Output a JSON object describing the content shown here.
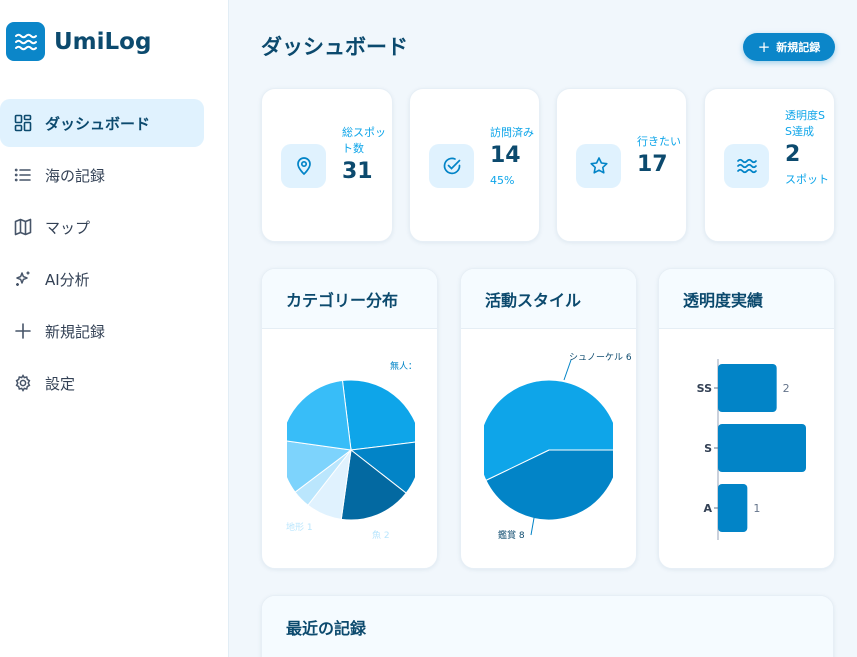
{
  "app": {
    "name": "UmiLog"
  },
  "sidebar": {
    "items": [
      {
        "label": "ダッシュボード",
        "icon": "grid-icon",
        "active": true
      },
      {
        "label": "海の記録",
        "icon": "list-icon",
        "active": false
      },
      {
        "label": "マップ",
        "icon": "map-icon",
        "active": false
      },
      {
        "label": "AI分析",
        "icon": "sparkles-icon",
        "active": false
      },
      {
        "label": "新規記録",
        "icon": "plus-icon",
        "active": false
      },
      {
        "label": "設定",
        "icon": "gear-icon",
        "active": false
      }
    ]
  },
  "header": {
    "title": "ダッシュボード",
    "new_button": "新規記録"
  },
  "stats": [
    {
      "label": "総スポット数",
      "value": "31",
      "sub": "",
      "icon": "pin-icon"
    },
    {
      "label": "訪問済み",
      "value": "14",
      "sub": "45%",
      "icon": "check-circle-icon"
    },
    {
      "label": "行きたい",
      "value": "17",
      "sub": "",
      "icon": "star-icon"
    },
    {
      "label": "透明度SS達成",
      "value": "2",
      "sub": "スポット",
      "icon": "waves-icon"
    }
  ],
  "cards": {
    "category": {
      "title": "カテゴリー分布"
    },
    "style": {
      "title": "活動スタイル"
    },
    "clarity": {
      "title": "透明度実績"
    },
    "recent": {
      "title": "最近の記録"
    }
  },
  "chart_data": [
    {
      "type": "pie",
      "title": "カテゴリー分布",
      "visible_labels": [
        "無人：",
        "地形 1",
        "魚 2"
      ],
      "slices": [
        {
          "label": "無人",
          "value": 6,
          "color": "#0ea5e9"
        },
        {
          "label": "",
          "value": 3,
          "color": "#0284c7"
        },
        {
          "label": "",
          "value": 4,
          "color": "#0369a1"
        },
        {
          "label": "魚",
          "value": 2,
          "color": "#e0f2fe"
        },
        {
          "label": "地形",
          "value": 1,
          "color": "#bae6fd"
        },
        {
          "label": "",
          "value": 3,
          "color": "#7dd3fc"
        },
        {
          "label": "",
          "value": 5,
          "color": "#38bdf8"
        }
      ]
    },
    {
      "type": "pie",
      "title": "活動スタイル",
      "visible_labels": [
        "シュノーケル 6",
        "鑑賞 8"
      ],
      "slices": [
        {
          "label": "シュノーケル",
          "value": 6,
          "color": "#0284c7"
        },
        {
          "label": "鑑賞",
          "value": 8,
          "color": "#0ea5e9"
        }
      ]
    },
    {
      "type": "bar",
      "orientation": "horizontal",
      "title": "透明度実績",
      "categories": [
        "SS",
        "S",
        "A"
      ],
      "values": [
        2,
        3,
        1
      ],
      "data_labels": [
        "2",
        "",
        "1"
      ],
      "color": "#0284c7"
    }
  ]
}
